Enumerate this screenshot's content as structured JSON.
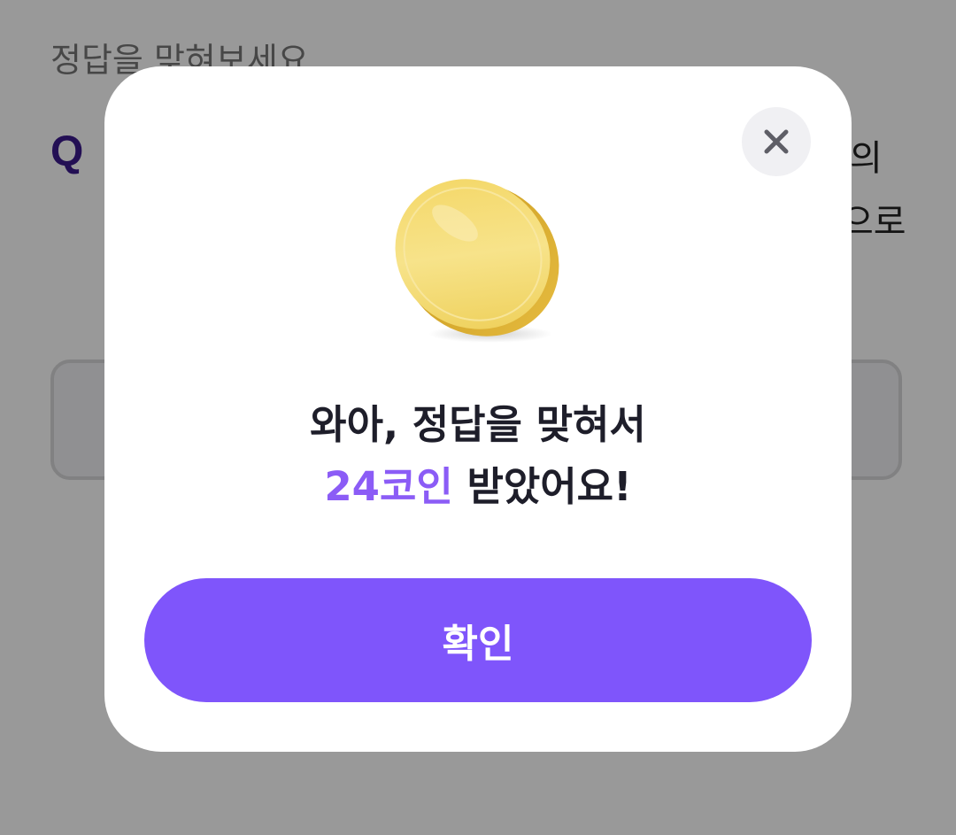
{
  "background": {
    "instruction": "정답을 맞혀보세요",
    "question_marker": "Q",
    "question_text_fragment_1": "의",
    "question_text_fragment_2": "으로"
  },
  "modal": {
    "close_icon": "close-icon",
    "coin_icon": "gold-coin-icon",
    "message_line1": "와아, 정답을 맞혀서",
    "message_coins": "24코인",
    "message_line2_rest": " 받았어요!",
    "confirm_label": "확인"
  },
  "colors": {
    "accent": "#7f55fb",
    "highlight_text": "#8b5cf6",
    "question_marker": "#3b1a8c"
  }
}
